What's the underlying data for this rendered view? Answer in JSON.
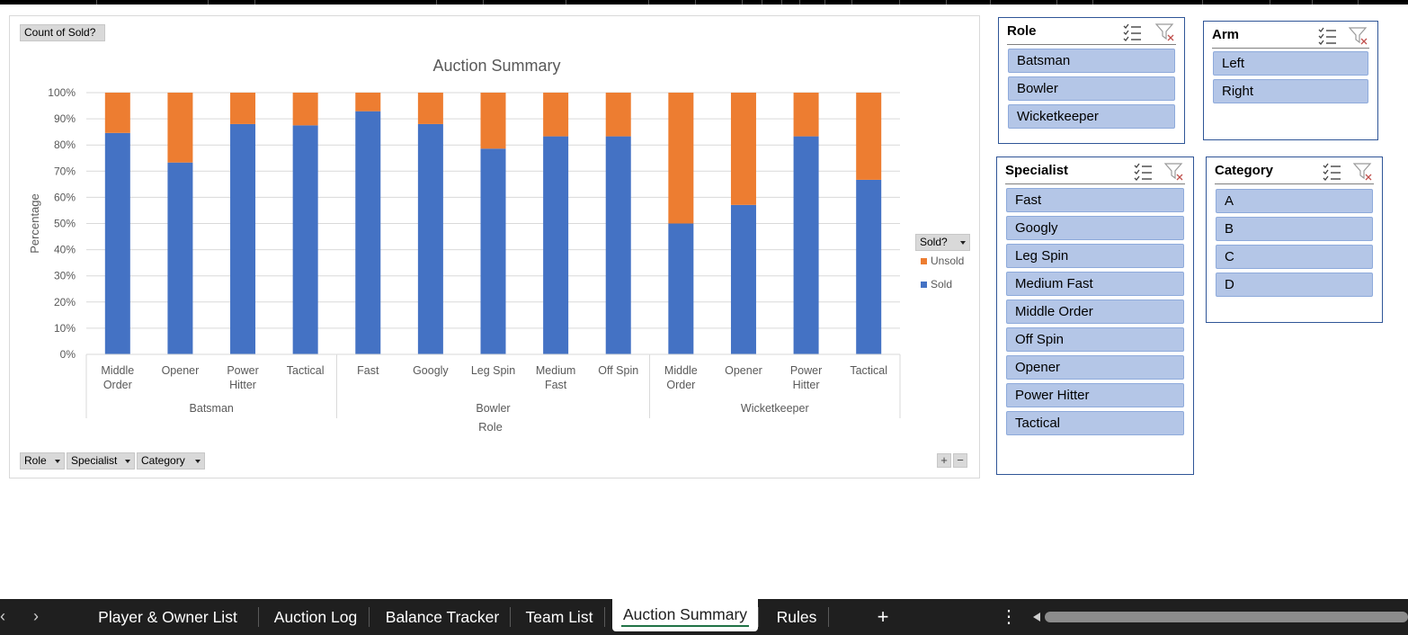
{
  "pivot_buttons": {
    "value_field": "Count of Sold?",
    "legend_field": "Sold?",
    "axis_fields": [
      "Role",
      "Specialist",
      "Category"
    ]
  },
  "chart_data": {
    "type": "bar",
    "stacked": "percent",
    "title": "Auction Summary",
    "xlabel": "Role",
    "ylabel": "Percentage",
    "ylim": [
      0,
      100
    ],
    "y_ticks": [
      "0%",
      "10%",
      "20%",
      "30%",
      "40%",
      "50%",
      "60%",
      "70%",
      "80%",
      "90%",
      "100%"
    ],
    "grid": true,
    "legend_placement": "right",
    "groups": [
      {
        "name": "Batsman",
        "categories": [
          "Middle Order",
          "Opener",
          "Power Hitter",
          "Tactical"
        ]
      },
      {
        "name": "Bowler",
        "categories": [
          "Fast",
          "Googly",
          "Leg Spin",
          "Medium Fast",
          "Off Spin"
        ]
      },
      {
        "name": "Wicketkeeper",
        "categories": [
          "Middle Order",
          "Opener",
          "Power Hitter",
          "Tactical"
        ]
      }
    ],
    "series": [
      {
        "name": "Sold",
        "color": "#4472c4",
        "values": [
          84.6,
          73.3,
          88,
          87.5,
          92.9,
          88,
          78.6,
          83.3,
          83.3,
          50,
          57.1,
          83.3,
          66.7
        ]
      },
      {
        "name": "Unsold",
        "color": "#ed7d31",
        "values": [
          15.4,
          26.7,
          12,
          12.5,
          7.1,
          12,
          21.4,
          16.7,
          16.7,
          50,
          42.9,
          16.7,
          33.3
        ]
      }
    ],
    "legend_order": [
      "Unsold",
      "Sold"
    ]
  },
  "slicers": {
    "role": {
      "title": "Role",
      "items": [
        "Batsman",
        "Bowler",
        "Wicketkeeper"
      ]
    },
    "arm": {
      "title": "Arm",
      "items": [
        "Left",
        "Right"
      ]
    },
    "specialist": {
      "title": "Specialist",
      "items": [
        "Fast",
        "Googly",
        "Leg Spin",
        "Medium Fast",
        "Middle Order",
        "Off Spin",
        "Opener",
        "Power Hitter",
        "Tactical"
      ]
    },
    "category": {
      "title": "Category",
      "items": [
        "A",
        "B",
        "C",
        "D"
      ]
    }
  },
  "zoom": {
    "plus": "+",
    "minus": "−"
  },
  "sheet_tabs": {
    "tabs": [
      "Player & Owner List",
      "Auction Log",
      "Balance Tracker",
      "Team List",
      "Auction Summary",
      "Rules"
    ],
    "active": "Auction Summary",
    "add_label": "+",
    "prev": "‹",
    "next": "›",
    "more": "⋮"
  }
}
